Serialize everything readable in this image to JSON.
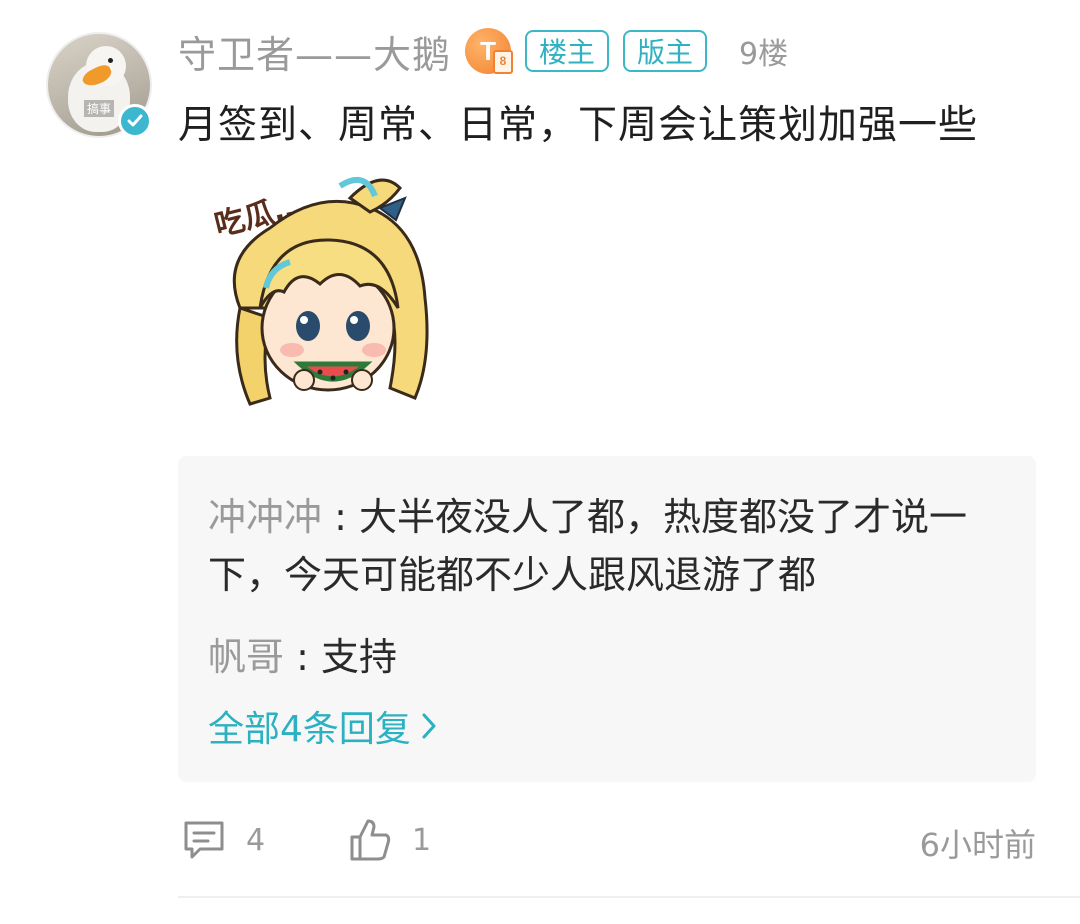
{
  "post": {
    "username": "守卫者——大鹅",
    "level_letter": "T",
    "level_number": "8",
    "avatar_tag": "搞事",
    "tags": [
      "楼主",
      "版主"
    ],
    "floor": "9楼",
    "text": "月签到、周常、日常，下周会让策划加强一些",
    "sticker_text": "吃瓜…"
  },
  "replies": [
    {
      "author": "冲冲冲",
      "separator": " : ",
      "text": "大半夜没人了都，热度都没了才说一下，今天可能都不少人跟风退游了都"
    },
    {
      "author": "帆哥",
      "separator": " : ",
      "text": "支持"
    }
  ],
  "more_replies": "全部4条回复",
  "footer": {
    "comment_count": "4",
    "like_count": "1",
    "time": "6小时前"
  },
  "colors": {
    "accent": "#2bb1c1",
    "muted": "#9a9a9a",
    "level_badge": "#f2822f",
    "reply_bg": "#f7f7f7"
  },
  "icons": [
    "verified-icon",
    "comment-icon",
    "like-icon",
    "chevron-right-icon"
  ]
}
